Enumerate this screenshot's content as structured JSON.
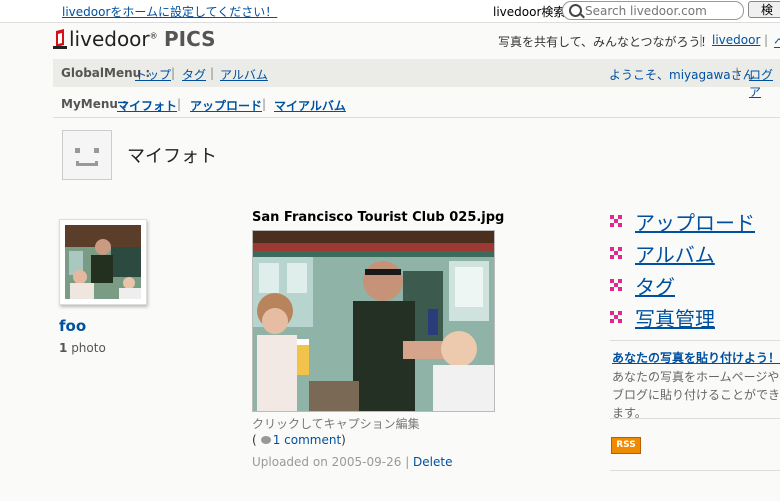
{
  "topbar": {
    "homepage_link": "livedoorをホームに設定してください！",
    "search_label": "livedoor検索",
    "search_placeholder": "Search livedoor.com",
    "search_button": "検"
  },
  "header": {
    "logo_word": "livedoor",
    "logo_product": "PICS",
    "tagline": "写真を共有して、みんなとつながろう！",
    "livedoor_link": "livedoor",
    "more_link": "ヘ"
  },
  "global_menu": {
    "label": "GlobalMenu :",
    "items": [
      "トップ",
      "タグ",
      "アルバム"
    ],
    "welcome": "ようこそ、miyagawaさん",
    "logout": "ログア"
  },
  "my_menu": {
    "label": "MyMenu :",
    "items": [
      "マイフォト",
      "アップロード",
      "マイアルバム"
    ]
  },
  "page": {
    "title": "マイフォト"
  },
  "user": {
    "name": "foo",
    "photo_count_num": "1",
    "photo_count_unit": "photo"
  },
  "photo": {
    "title": "San Francisco Tourist Club 025.jpg",
    "caption_hint": "クリックしてキャプション編集",
    "comment_link": "1 comment",
    "uploaded": "Uploaded on 2005-09-26",
    "delete": "Delete"
  },
  "sidebar": {
    "links": [
      "アップロード",
      "アルバム",
      "タグ",
      "写真管理"
    ],
    "paste_title": "あなたの写真を貼り付けよう！",
    "paste_desc": "あなたの写真をホームページやブログに貼り付けることができます。",
    "rss": "RSS"
  },
  "colors": {
    "link": "#0050a0",
    "bullet": "#e0288e",
    "rss": "#f08a00"
  }
}
